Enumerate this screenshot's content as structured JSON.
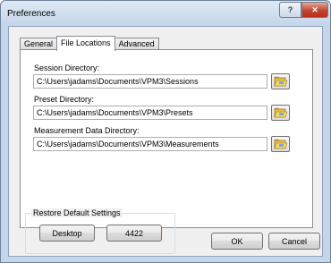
{
  "window": {
    "title": "Preferences",
    "help_glyph": "?",
    "close_glyph": "✕"
  },
  "tabs": [
    {
      "label": "General"
    },
    {
      "label": "File Locations"
    },
    {
      "label": "Advanced"
    }
  ],
  "directories": [
    {
      "label": "Session Directory:",
      "value": "C:\\Users\\jadams\\Documents\\VPM3\\Sessions",
      "icon": "folder-browse-icon"
    },
    {
      "label": "Preset Directory:",
      "value": "C:\\Users\\jadams\\Documents\\VPM3\\Presets",
      "icon": "folder-browse-icon"
    },
    {
      "label": "Measurement Data Directory:",
      "value": "C:\\Users\\jadams\\Documents\\VPM3\\Measurements",
      "icon": "folder-browse-icon"
    }
  ],
  "restore_defaults": {
    "title": "Restore Default Settings",
    "buttons": [
      {
        "label": "Desktop"
      },
      {
        "label": "4422"
      }
    ]
  },
  "dialog_buttons": {
    "ok": "OK",
    "cancel": "Cancel"
  }
}
